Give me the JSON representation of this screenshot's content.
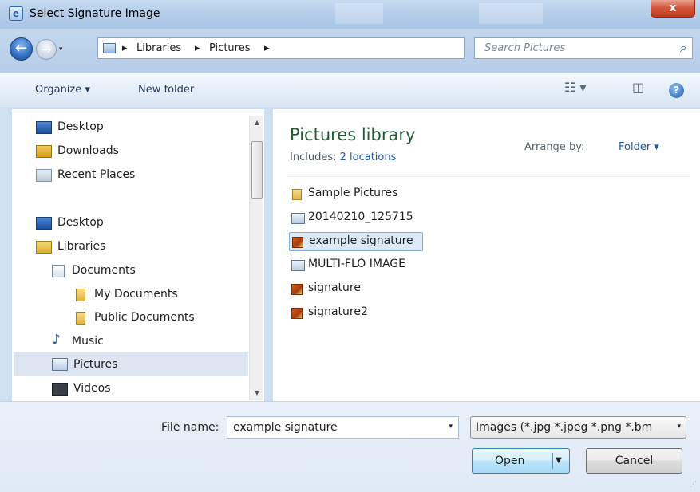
{
  "window": {
    "title": "Select Signature Image",
    "app_icon": "e",
    "close_glyph": "x"
  },
  "address": {
    "crumbs": [
      "Libraries",
      "Pictures"
    ],
    "separator": "▸",
    "dropdown_glyph": "▾",
    "refresh_glyph": "⟳"
  },
  "search": {
    "placeholder": "Search Pictures",
    "icon": "search-icon"
  },
  "toolbar": {
    "organize_label": "Organize ▾",
    "new_folder_label": "New folder",
    "views_glyph": "☷ ▾",
    "preview_glyph": "◫",
    "help_glyph": "?"
  },
  "nav": {
    "items": [
      {
        "label": "Desktop",
        "icon": "desktop-icon"
      },
      {
        "label": "Downloads",
        "icon": "downloads-icon"
      },
      {
        "label": "Recent Places",
        "icon": "recent-places-icon"
      },
      {
        "label": "Desktop",
        "icon": "desktop-icon"
      },
      {
        "label": "Libraries",
        "icon": "libraries-icon"
      },
      {
        "label": "Documents",
        "icon": "documents-icon"
      },
      {
        "label": "My Documents",
        "icon": "folder-icon"
      },
      {
        "label": "Public Documents",
        "icon": "folder-icon"
      },
      {
        "label": "Music",
        "icon": "music-icon"
      },
      {
        "label": "Pictures",
        "icon": "pictures-icon",
        "selected": true
      },
      {
        "label": "Videos",
        "icon": "videos-icon"
      }
    ]
  },
  "library": {
    "title": "Pictures library",
    "includes_label": "Includes:",
    "includes_link": "2 locations",
    "arrange_label": "Arrange by:",
    "arrange_value": "Folder ▾"
  },
  "files": [
    {
      "label": "Sample Pictures",
      "icon": "folder-icon"
    },
    {
      "label": "20140210_125715",
      "icon": "image-file-icon"
    },
    {
      "label": "example signature",
      "icon": "image-file-icon",
      "selected": true
    },
    {
      "label": "MULTI-FLO IMAGE",
      "icon": "image-file-icon"
    },
    {
      "label": "signature",
      "icon": "image-file-icon"
    },
    {
      "label": "signature2",
      "icon": "image-file-icon"
    }
  ],
  "footer": {
    "file_name_label": "File name:",
    "file_name_value": "example signature",
    "file_type_value": "Images (*.jpg *.jpeg *.png *.bm",
    "open_label": "Open",
    "cancel_label": "Cancel",
    "dropdown_glyph": "▾"
  },
  "colors": {
    "accent": "#1c5aa8",
    "library_title": "#1e5b32",
    "selection": "#dce9f8"
  }
}
